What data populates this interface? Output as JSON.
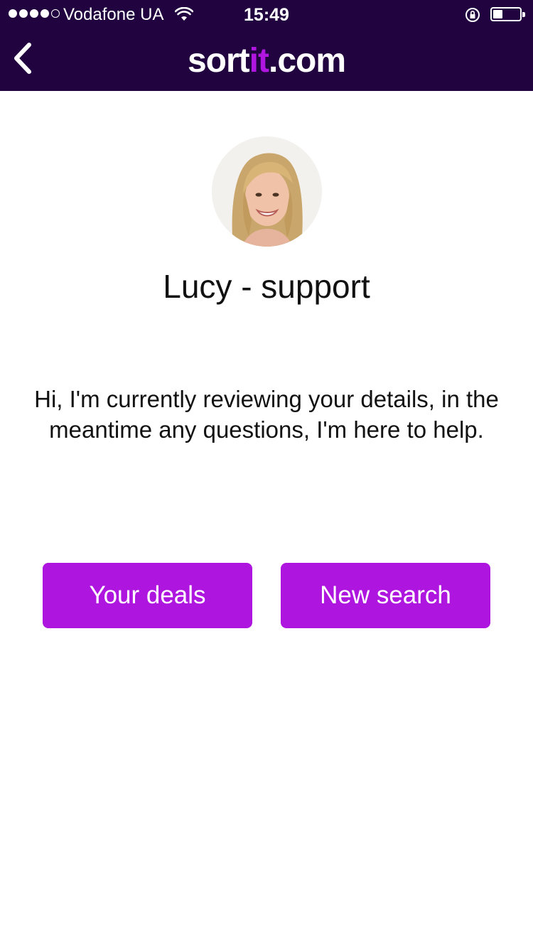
{
  "status_bar": {
    "carrier": "Vodafone UA",
    "time": "15:49",
    "signal_bars": 4,
    "signal_total": 5,
    "battery_level": 0.35
  },
  "nav": {
    "back_icon": "chevron-left-icon",
    "logo": {
      "part1": "sort",
      "part2": "it",
      "part3": ".com"
    }
  },
  "agent": {
    "name": "Lucy - support",
    "avatar_icon": "avatar-photo"
  },
  "message": "Hi, I'm currently reviewing your details, in the meantime any questions, I'm here to help.",
  "actions": {
    "your_deals": "Your deals",
    "new_search": "New search"
  },
  "colors": {
    "header_bg": "#21043f",
    "accent": "#ae16e0",
    "text": "#111111"
  }
}
